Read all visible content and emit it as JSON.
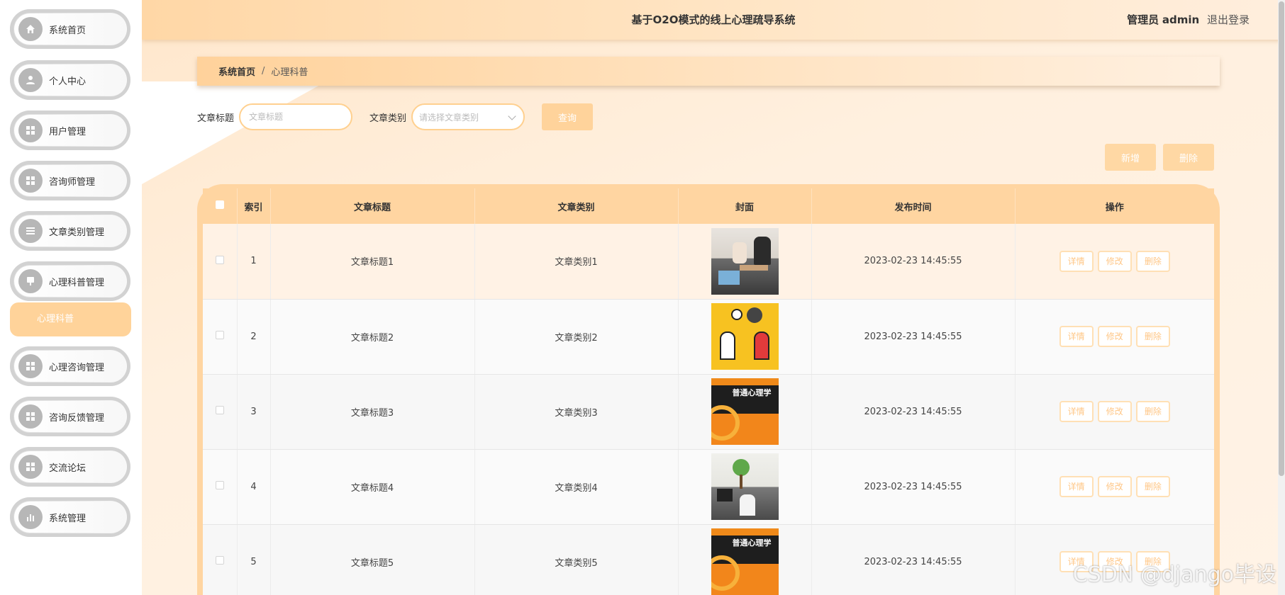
{
  "header": {
    "title": "基于O2O模式的线上心理疏导系统",
    "user_role": "管理员",
    "user_name": "admin",
    "logout": "退出登录"
  },
  "sidebar": {
    "items": [
      {
        "label": "系统首页",
        "icon": "home-icon"
      },
      {
        "label": "个人中心",
        "icon": "user-icon"
      },
      {
        "label": "用户管理",
        "icon": "grid-icon"
      },
      {
        "label": "咨询师管理",
        "icon": "grid-icon"
      },
      {
        "label": "文章类别管理",
        "icon": "list-icon"
      },
      {
        "label": "心理科普管理",
        "icon": "pin-icon"
      },
      {
        "label": "心理咨询管理",
        "icon": "grid-icon"
      },
      {
        "label": "咨询反馈管理",
        "icon": "grid-icon"
      },
      {
        "label": "交流论坛",
        "icon": "grid-icon"
      },
      {
        "label": "系统管理",
        "icon": "bar-chart-icon"
      }
    ],
    "active_sub": "心理科普"
  },
  "breadcrumb": {
    "home": "系统首页",
    "separator": "/",
    "current": "心理科普"
  },
  "search": {
    "title_label": "文章标题",
    "title_placeholder": "文章标题",
    "category_label": "文章类别",
    "category_placeholder": "请选择文章类别",
    "query_button": "查询"
  },
  "actions": {
    "add": "新增",
    "delete": "删除"
  },
  "table": {
    "columns": [
      "索引",
      "文章标题",
      "文章类别",
      "封面",
      "发布时间",
      "操作"
    ],
    "rows": [
      {
        "index": "1",
        "title": "文章标题1",
        "category": "文章类别1",
        "cover": "photo-counseling-office",
        "time": "2023-02-23 14:45:55"
      },
      {
        "index": "2",
        "title": "文章标题2",
        "category": "文章类别2",
        "cover": "illustration-two-people-talking",
        "time": "2023-02-23 14:45:55"
      },
      {
        "index": "3",
        "title": "文章标题3",
        "category": "文章类别3",
        "cover": "book-cover-psychology",
        "time": "2023-02-23 14:45:55"
      },
      {
        "index": "4",
        "title": "文章标题4",
        "category": "文章类别4",
        "cover": "photo-therapy-room",
        "time": "2023-02-23 14:45:55"
      },
      {
        "index": "5",
        "title": "文章标题5",
        "category": "文章类别5",
        "cover": "book-cover-psychology",
        "time": "2023-02-23 14:45:55"
      }
    ],
    "row_actions": {
      "detail": "详情",
      "edit": "修改",
      "delete": "删除"
    },
    "book_cover_text": "普通心理学"
  },
  "watermark": "CSDN @django毕设",
  "colors": {
    "accent": "#ffd39b",
    "header_bg": "#ffd7a6",
    "sidebar_active": "#ffd39a",
    "op_button_text": "#ffc787"
  }
}
